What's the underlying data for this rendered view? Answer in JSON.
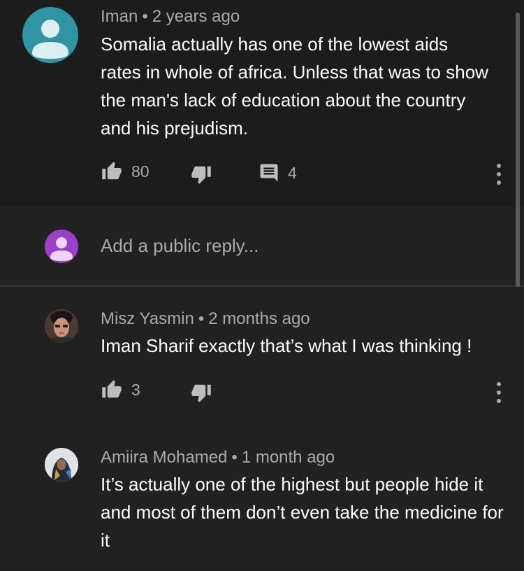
{
  "comments": {
    "main": {
      "author": "Iman",
      "separator": "•",
      "time": "2 years ago",
      "text": "Somalia actually has one of the lowest aids rates in whole of africa. Unless that was to show the man's lack of education about the country and his prejudism.",
      "likes": "80",
      "replies": "4",
      "avatar_color": "#2f95a3"
    },
    "reply_box": {
      "placeholder": "Add a public reply...",
      "avatar_color": "#9c3fc9"
    },
    "reply1": {
      "author": "Misz Yasmin",
      "separator": "•",
      "time": "2 months ago",
      "text": "Iman Sharif exactly that’s what I was thinking !",
      "likes": "3"
    },
    "reply2": {
      "author": "Amiira Mohamed",
      "separator": "•",
      "time": "1 month ago",
      "text": "It’s actually one of the highest but people hide it and most of them don’t even take the medicine for it"
    }
  },
  "icons": {
    "like": "thumbs-up-icon",
    "dislike": "thumbs-down-icon",
    "reply": "comment-icon",
    "more": "more-vertical-icon"
  }
}
